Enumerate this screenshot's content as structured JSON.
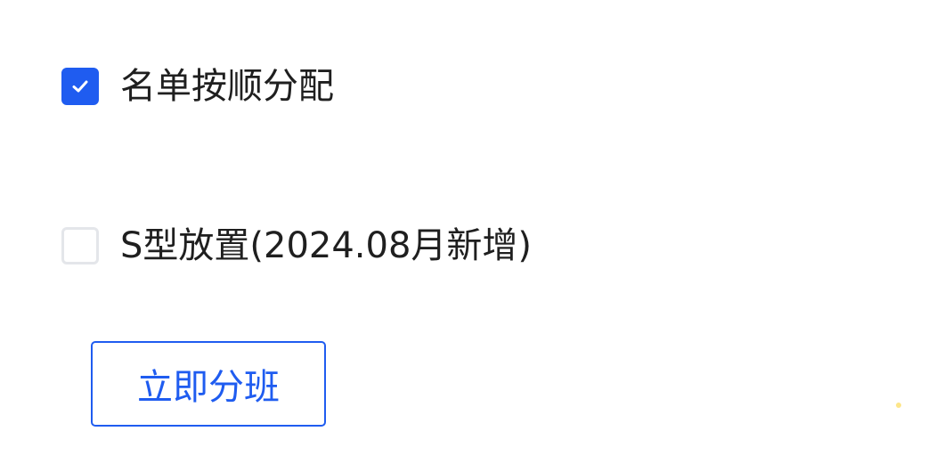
{
  "options": [
    {
      "label": "名单按顺分配",
      "checked": true
    },
    {
      "label": "S型放置(2024.08月新增)",
      "checked": false
    }
  ],
  "actions": {
    "submit_label": "立即分班"
  },
  "colors": {
    "accent": "#1f5cf0",
    "checkbox_border": "#e4e6ea",
    "text": "#1f1f1f"
  }
}
